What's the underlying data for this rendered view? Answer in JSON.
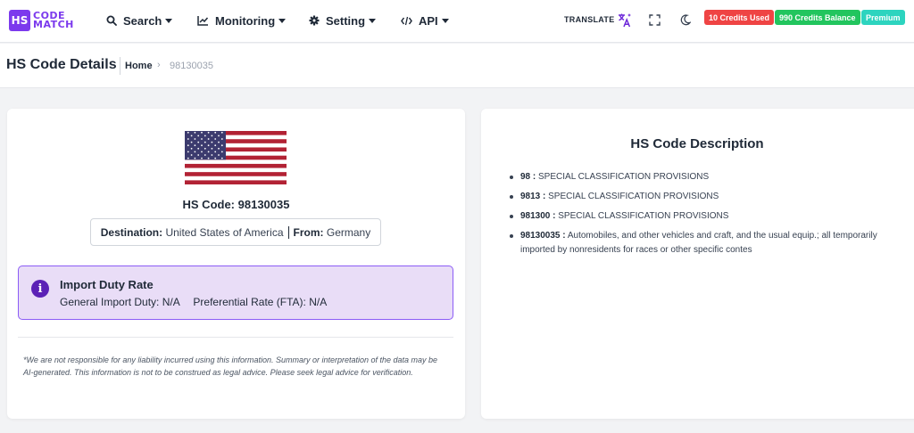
{
  "logo": {
    "box_text": "HS",
    "line1": "CODE",
    "line2": "MATCH"
  },
  "nav": {
    "search": "Search",
    "monitoring": "Monitoring",
    "setting": "Setting",
    "api": "API"
  },
  "topbar": {
    "translate": "TRANSLATE",
    "credits_used": "10 Credits Used",
    "credits_balance": "990 Credits Balance",
    "plan": "Premium"
  },
  "colors": {
    "accent": "#7c3aed",
    "credits_used": "#ef4444",
    "credits_balance": "#22c55e",
    "premium": "#2dd4bf",
    "duty_bg": "#e9ddf7"
  },
  "page": {
    "title": "HS Code Details",
    "breadcrumb_home": "Home",
    "breadcrumb_current": "98130035"
  },
  "details": {
    "hs_code_label": "HS Code: 98130035",
    "destination_label": "Destination:",
    "destination_value": "United States of America",
    "from_label": "From:",
    "from_value": "Germany"
  },
  "duty": {
    "title": "Import Duty Rate",
    "general": "General Import Duty: N/A",
    "preferential": "Preferential Rate (FTA): N/A"
  },
  "disclaimer": "*We are not responsible for any liability incurred using this information. Summary or interpretation of the data may be AI-generated. This information is not to be construed as legal advice. Please seek legal advice for verification.",
  "description": {
    "title": "HS Code Description",
    "items": [
      {
        "code": "98 :",
        "text": "SPECIAL CLASSIFICATION PROVISIONS"
      },
      {
        "code": "9813 :",
        "text": "SPECIAL CLASSIFICATION PROVISIONS"
      },
      {
        "code": "981300 :",
        "text": "SPECIAL CLASSIFICATION PROVISIONS"
      },
      {
        "code": "98130035 :",
        "text": "Automobiles, and other vehicles and craft, and the usual equip.; all temporarily imported by nonresidents for races or other specific contes"
      }
    ]
  }
}
